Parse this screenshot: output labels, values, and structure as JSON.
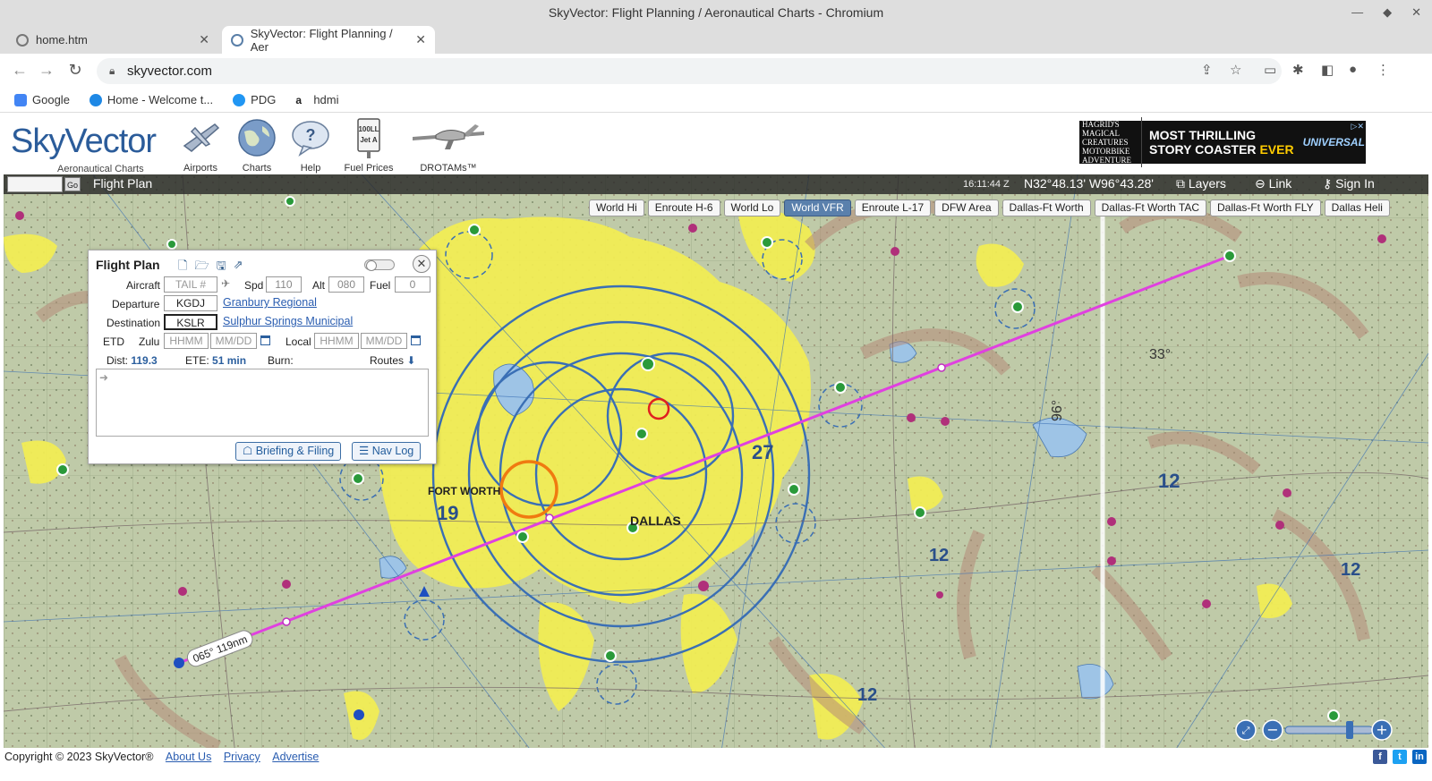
{
  "browser": {
    "window_title": "SkyVector: Flight Planning / Aeronautical Charts - Chromium",
    "tabs": [
      {
        "label": "home.htm"
      },
      {
        "label": "SkyVector: Flight Planning / Aer"
      }
    ],
    "url": "skyvector.com",
    "bookmarks": [
      {
        "label": "Google",
        "color": "#4285f4"
      },
      {
        "label": "Home - Welcome t...",
        "color": "#1e88e5"
      },
      {
        "label": "PDG",
        "color": "#2196f3"
      },
      {
        "label": "hdmi",
        "color": "#222222"
      }
    ]
  },
  "header": {
    "logo_text": "SkyVector",
    "logo_sub": "Aeronautical Charts",
    "nav": [
      {
        "label": "Airports"
      },
      {
        "label": "Charts"
      },
      {
        "label": "Help"
      },
      {
        "label": "Fuel Prices"
      },
      {
        "label": "DROTAMs™"
      }
    ],
    "ad": {
      "brand": "HAGRID'S MAGICAL CREATURES MOTORBIKE ADVENTURE",
      "line1": "MOST THRILLING",
      "line2a": "STORY COASTER ",
      "line2b": "EVER",
      "sponsor": "UNIVERSAL"
    }
  },
  "map_bar": {
    "go_label": "Go",
    "flight_plan_link": "Flight Plan",
    "zulu_time": "16:11:44 Z",
    "coordinates": "N32°48.13' W96°43.28'",
    "layers": "Layers",
    "link": "Link",
    "sign_in": "Sign In"
  },
  "chart_tabs": [
    {
      "label": "World Hi",
      "selected": false
    },
    {
      "label": "Enroute H-6",
      "selected": false
    },
    {
      "label": "World Lo",
      "selected": false
    },
    {
      "label": "World VFR",
      "selected": true
    },
    {
      "label": "Enroute L-17",
      "selected": false
    },
    {
      "label": "DFW Area",
      "selected": false
    },
    {
      "label": "Dallas-Ft Worth",
      "selected": false
    },
    {
      "label": "Dallas-Ft Worth TAC",
      "selected": false
    },
    {
      "label": "Dallas-Ft Worth FLY",
      "selected": false
    },
    {
      "label": "Dallas Heli",
      "selected": false
    }
  ],
  "flight_plan": {
    "title": "Flight Plan",
    "aircraft_label": "Aircraft",
    "aircraft_placeholder": "TAIL #",
    "spd_label": "Spd",
    "spd_value": "110",
    "alt_label": "Alt",
    "alt_value": "080",
    "fuel_label": "Fuel",
    "fuel_value": "0",
    "departure_label": "Departure",
    "departure_value": "KGDJ",
    "departure_name": "Granbury Regional",
    "destination_label": "Destination",
    "destination_value": "KSLR",
    "destination_name": "Sulphur Springs Municipal",
    "etd_label": "ETD",
    "zulu_label": "Zulu",
    "local_label": "Local",
    "time_placeholder": "HHMM",
    "date_placeholder": "MM/DD",
    "dist_label": "Dist:",
    "dist_value": "119.3",
    "ete_label": "ETE:",
    "ete_value": "51 min",
    "burn_label": "Burn:",
    "routes_label": "Routes",
    "briefing_label": "Briefing & Filing",
    "navlog_label": "Nav Log"
  },
  "map": {
    "route_label": "065° 119nm",
    "route_color": "#e040e0",
    "chart_numbers": [
      "19",
      "12",
      "12",
      "12",
      "12",
      "27",
      "33°",
      "96°"
    ],
    "city_label": "DALLAS",
    "fort_worth_label": "FORT WORTH"
  },
  "footer": {
    "copyright": "Copyright © 2023 SkyVector®",
    "links": [
      "About Us",
      "Privacy",
      "Advertise"
    ]
  }
}
